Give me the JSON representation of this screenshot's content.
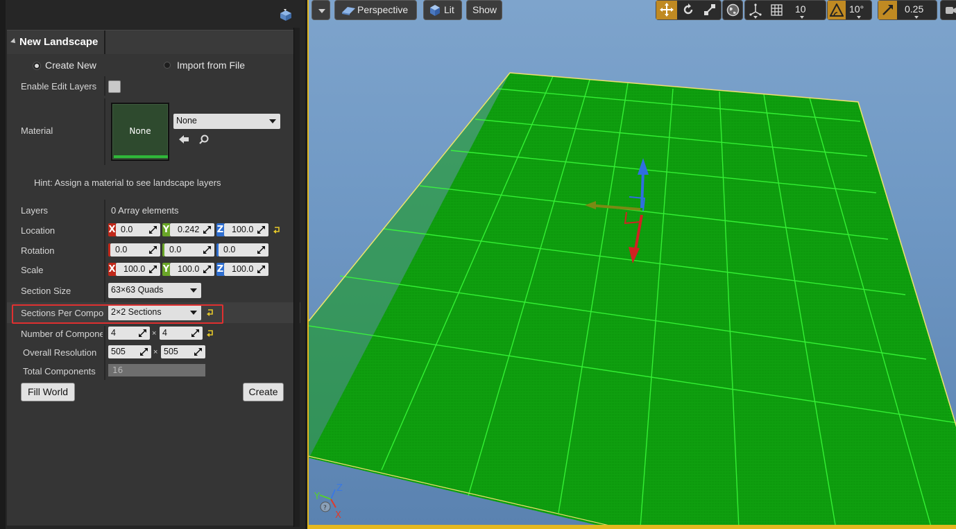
{
  "panel": {
    "section_title": "New Landscape",
    "mode_create": "Create New",
    "mode_import": "Import from File",
    "mode_selected": "Create New",
    "enable_edit_layers_label": "Enable Edit Layers",
    "enable_edit_layers_checked": false,
    "material_label": "Material",
    "material_thumb_text": "None",
    "material_combo": "None",
    "hint": "Hint: Assign a material to see landscape layers",
    "layers_label": "Layers",
    "layers_value": "0 Array elements",
    "location_label": "Location",
    "location": {
      "x": "0.0",
      "y": "0.242",
      "z": "100.0"
    },
    "rotation_label": "Rotation",
    "rotation": {
      "x": "0.0",
      "y": "0.0",
      "z": "0.0"
    },
    "scale_label": "Scale",
    "scale": {
      "x": "100.0",
      "y": "100.0",
      "z": "100.0"
    },
    "section_size_label": "Section Size",
    "section_size": "63×63 Quads",
    "sections_per_component_label": "Sections Per Component",
    "sections_per_component": "2×2 Sections",
    "num_components_label": "Number of Components",
    "num_components": {
      "x": "4",
      "y": "4"
    },
    "overall_resolution_label": "Overall Resolution",
    "overall_resolution": {
      "x": "505",
      "y": "505"
    },
    "total_components_label": "Total Components",
    "total_components": "16",
    "times_sign": "×",
    "fill_world_button": "Fill World",
    "create_button": "Create"
  },
  "viewport": {
    "perspective_label": "Perspective",
    "lit_label": "Lit",
    "show_label": "Show",
    "grid_snap": "10",
    "rotation_snap": "10°",
    "scale_snap": "0.25",
    "axis_labels": {
      "x": "X",
      "y": "Y",
      "z": "Z"
    }
  },
  "colors": {
    "landscape_green": "#0f9a0f",
    "grid_line": "#3bff3b",
    "selection_outline": "#e03030",
    "active_tool": "#c08a22",
    "viewport_border": "#e3b820"
  },
  "icons": [
    "panel-menu-icon",
    "collapse-arrow-icon",
    "use-selected-arrow-icon",
    "browse-search-icon",
    "reset-to-default-icon",
    "spinner-drag-icon",
    "viewport-options-icon",
    "perspective-icon",
    "lit-cube-icon",
    "translate-icon",
    "rotate-icon",
    "scale-icon",
    "world-local-icon",
    "surface-snap-icon",
    "grid-snap-icon",
    "rotation-snap-icon",
    "scale-snap-icon",
    "camera-speed-icon"
  ]
}
